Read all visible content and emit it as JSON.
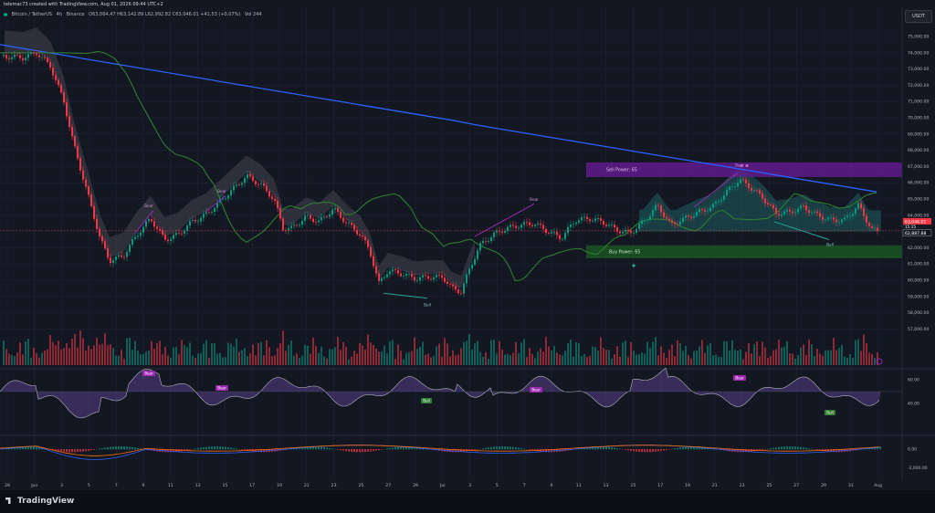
{
  "header": {
    "credit": "telemac73 created with TradingView.com, Aug 01, 2026 09:44 UTC+2",
    "symbol": "Bitcoin / TetherUS",
    "interval": "4h",
    "exchange": "Binance",
    "ohlc": "O63,064.47 H63,142.89 L62,992.82 C63,046.01 +41.53 (+0.07%)",
    "volume": "Vol 244"
  },
  "currency_button": "USDT",
  "colors": {
    "background": "#131722",
    "bull": "#089981",
    "bear": "#f23645",
    "ma_blue": "#2962ff",
    "ma_green": "#2e7d32",
    "sell_zone": "#6a1b9a",
    "buy_zone": "#1b5e20",
    "divergence": "#9c27b0"
  },
  "price_axis": {
    "ticks": [
      "75,000.00",
      "74,000.00",
      "73,000.00",
      "72,000.00",
      "71,000.00",
      "70,000.00",
      "69,000.00",
      "68,000.00",
      "67,000.00",
      "66,000.00",
      "65,000.00",
      "64,000.00",
      "62,000.00",
      "61,000.00",
      "60,000.00",
      "59,000.00",
      "58,000.00",
      "57,000.00"
    ],
    "current_price": "63,046.01",
    "countdown": "15:15",
    "level_label": "62,887.88"
  },
  "oscillator_axis": {
    "ticks": [
      "60.00",
      "40.00"
    ]
  },
  "macd_axis": {
    "ticks": [
      "0.00",
      "-2,000.00"
    ]
  },
  "time_axis": {
    "ticks": [
      "29",
      "Jun",
      "3",
      "5",
      "7",
      "9",
      "11",
      "13",
      "15",
      "17",
      "19",
      "21",
      "23",
      "25",
      "27",
      "29",
      "Jul",
      "3",
      "5",
      "7",
      "9",
      "11",
      "13",
      "15",
      "17",
      "19",
      "21",
      "23",
      "25",
      "27",
      "29",
      "31",
      "Aug"
    ]
  },
  "zones": {
    "sell_label": "Sell Power: 65",
    "buy_label": "Buy Power: 65"
  },
  "divergence_labels": {
    "bear": "Bear",
    "bull": "Bull"
  },
  "branding": "TradingView",
  "chart_data": {
    "type": "candlestick",
    "symbol": "BTCUSDT",
    "price_range": [
      56500,
      75800
    ],
    "close_path": [
      [
        0,
        73800
      ],
      [
        25,
        73700
      ],
      [
        40,
        74000
      ],
      [
        55,
        73200
      ],
      [
        70,
        71000
      ],
      [
        80,
        68500
      ],
      [
        90,
        66500
      ],
      [
        100,
        64500
      ],
      [
        110,
        62500
      ],
      [
        120,
        61200
      ],
      [
        135,
        61500
      ],
      [
        150,
        62800
      ],
      [
        165,
        63800
      ],
      [
        180,
        62500
      ],
      [
        195,
        62800
      ],
      [
        210,
        63600
      ],
      [
        225,
        64000
      ],
      [
        240,
        64800
      ],
      [
        255,
        65600
      ],
      [
        270,
        66400
      ],
      [
        285,
        65900
      ],
      [
        300,
        65000
      ],
      [
        310,
        63200
      ],
      [
        320,
        63200
      ],
      [
        335,
        63900
      ],
      [
        350,
        63600
      ],
      [
        365,
        64400
      ],
      [
        380,
        63500
      ],
      [
        395,
        62800
      ],
      [
        405,
        61800
      ],
      [
        415,
        59800
      ],
      [
        425,
        60600
      ],
      [
        440,
        60400
      ],
      [
        455,
        60100
      ],
      [
        470,
        60200
      ],
      [
        485,
        60200
      ],
      [
        495,
        59500
      ],
      [
        505,
        59300
      ],
      [
        515,
        60800
      ],
      [
        525,
        62100
      ],
      [
        540,
        62800
      ],
      [
        555,
        63200
      ],
      [
        570,
        63400
      ],
      [
        585,
        63500
      ],
      [
        600,
        63000
      ],
      [
        615,
        62600
      ],
      [
        630,
        63700
      ],
      [
        645,
        63800
      ],
      [
        660,
        63600
      ],
      [
        675,
        63100
      ],
      [
        690,
        62900
      ],
      [
        705,
        63600
      ],
      [
        720,
        64600
      ],
      [
        735,
        63400
      ],
      [
        750,
        63800
      ],
      [
        765,
        64200
      ],
      [
        780,
        64500
      ],
      [
        795,
        65400
      ],
      [
        810,
        66200
      ],
      [
        820,
        65800
      ],
      [
        835,
        65100
      ],
      [
        850,
        64100
      ],
      [
        865,
        64200
      ],
      [
        880,
        64500
      ],
      [
        895,
        64000
      ],
      [
        910,
        63700
      ],
      [
        925,
        63700
      ],
      [
        940,
        64600
      ],
      [
        955,
        63100
      ],
      [
        965,
        63000
      ]
    ],
    "series": [
      {
        "name": "",
        "values": "blue moving average"
      },
      {
        "name": "",
        "values": "green moving average"
      }
    ],
    "oscillator": {
      "levels": [
        60,
        40
      ]
    },
    "macd": {
      "zero": 0
    }
  }
}
